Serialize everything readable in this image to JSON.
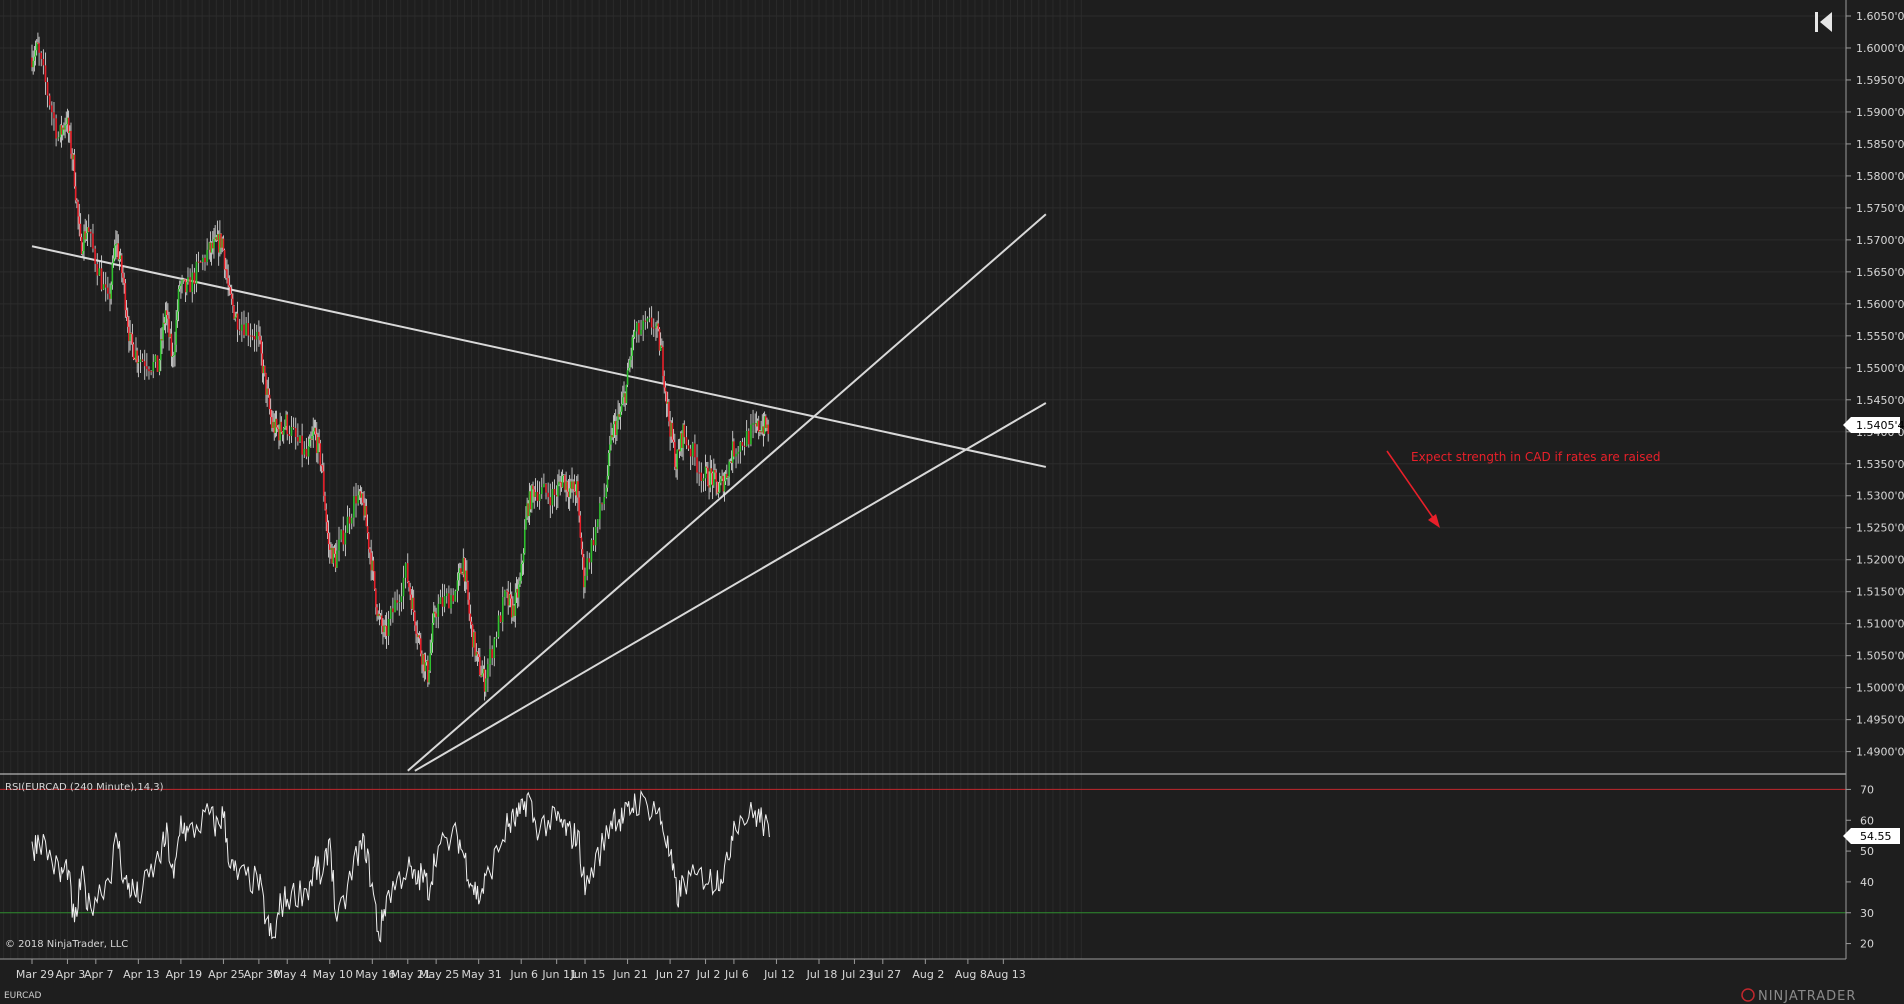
{
  "instrument": "EURCAD",
  "copyright": "© 2018 NinjaTrader, LLC",
  "brand": "NINJATRADER",
  "indicator_label": "RSI(EURCAD (240 Minute),14,3)",
  "price_badge": "1.5405'4",
  "rsi_badge": "54.55",
  "annotation": "Expect strength in CAD if rates are raised",
  "colors": {
    "up": "#2fc12f",
    "down": "#e8202a",
    "line": "#d8d8d8",
    "background": "#1e1e1e",
    "overbought": "#c0272d",
    "oversold": "#2e8b2e",
    "annotation": "#e8202a"
  },
  "chart_data": [
    {
      "type": "candlestick",
      "title": "EURCAD 240 Minute",
      "ylim": [
        1.4865,
        1.6075
      ],
      "y_ticks": [
        1.605,
        1.6,
        1.595,
        1.59,
        1.585,
        1.58,
        1.575,
        1.57,
        1.565,
        1.56,
        1.555,
        1.55,
        1.545,
        1.54,
        1.535,
        1.53,
        1.525,
        1.52,
        1.515,
        1.51,
        1.505,
        1.5,
        1.495,
        1.49
      ],
      "y_tick_labels": [
        "1.6050'0",
        "1.6000'0",
        "1.5950'0",
        "1.5900'0",
        "1.5850'0",
        "1.5800'0",
        "1.5750'0",
        "1.5700'0",
        "1.5650'0",
        "1.5600'0",
        "1.5550'0",
        "1.5500'0",
        "1.5450'0",
        "1.5400'0",
        "1.5350'0",
        "1.5300'0",
        "1.5250'0",
        "1.5200'0",
        "1.5150'0",
        "1.5100'0",
        "1.5050'0",
        "1.5000'0",
        "1.4950'0",
        "1.4900'0"
      ],
      "x_tick_labels": [
        "Mar 29",
        "Apr 3",
        "Apr 7",
        "Apr 13",
        "Apr 19",
        "Apr 25",
        "Apr 30",
        "May 4",
        "May 10",
        "May 16",
        "May 21",
        "May 25",
        "May 31",
        "Jun 6",
        "Jun 11",
        "Jun 15",
        "Jun 21",
        "Jun 27",
        "Jul 2",
        "Jul 6",
        "Jul 12",
        "Jul 18",
        "Jul 23",
        "Jul 27",
        "Aug 2",
        "Aug 8",
        "Aug 13"
      ],
      "anchors": [
        {
          "date": "Mar 29",
          "close": 1.5985
        },
        {
          "date": "Mar 30",
          "close": 1.6
        },
        {
          "date": "Apr 2",
          "close": 1.586
        },
        {
          "date": "Apr 3",
          "close": 1.589
        },
        {
          "date": "Apr 4",
          "close": 1.582
        },
        {
          "date": "Apr 5",
          "close": 1.569
        },
        {
          "date": "Apr 6",
          "close": 1.572
        },
        {
          "date": "Apr 9",
          "close": 1.56
        },
        {
          "date": "Apr 10",
          "close": 1.57
        },
        {
          "date": "Apr 11",
          "close": 1.564
        },
        {
          "date": "Apr 12",
          "close": 1.554
        },
        {
          "date": "Apr 13",
          "close": 1.552
        },
        {
          "date": "Apr 16",
          "close": 1.55
        },
        {
          "date": "Apr 17",
          "close": 1.559
        },
        {
          "date": "Apr 18",
          "close": 1.551
        },
        {
          "date": "Apr 19",
          "close": 1.563
        },
        {
          "date": "Apr 20",
          "close": 1.562
        },
        {
          "date": "Apr 23",
          "close": 1.568
        },
        {
          "date": "Apr 24",
          "close": 1.569
        },
        {
          "date": "Apr 25",
          "close": 1.57
        },
        {
          "date": "Apr 26",
          "close": 1.561
        },
        {
          "date": "Apr 27",
          "close": 1.558
        },
        {
          "date": "Apr 30",
          "close": 1.555
        },
        {
          "date": "May 1",
          "close": 1.548
        },
        {
          "date": "May 2",
          "close": 1.541
        },
        {
          "date": "May 3",
          "close": 1.54
        },
        {
          "date": "May 4",
          "close": 1.5415
        },
        {
          "date": "May 7",
          "close": 1.536
        },
        {
          "date": "May 8",
          "close": 1.54
        },
        {
          "date": "May 9",
          "close": 1.535
        },
        {
          "date": "May 10",
          "close": 1.522
        },
        {
          "date": "May 11",
          "close": 1.52
        },
        {
          "date": "May 14",
          "close": 1.53
        },
        {
          "date": "May 15",
          "close": 1.528
        },
        {
          "date": "May 16",
          "close": 1.52
        },
        {
          "date": "May 17",
          "close": 1.511
        },
        {
          "date": "May 18",
          "close": 1.508
        },
        {
          "date": "May 21",
          "close": 1.518
        },
        {
          "date": "May 22",
          "close": 1.512
        },
        {
          "date": "May 23",
          "close": 1.506
        },
        {
          "date": "May 24",
          "close": 1.502
        },
        {
          "date": "May 25",
          "close": 1.512
        },
        {
          "date": "May 28",
          "close": 1.515
        },
        {
          "date": "May 29",
          "close": 1.52
        },
        {
          "date": "May 30",
          "close": 1.51
        },
        {
          "date": "May 31",
          "close": 1.504
        },
        {
          "date": "Jun 1",
          "close": 1.501
        },
        {
          "date": "Jun 4",
          "close": 1.514
        },
        {
          "date": "Jun 5",
          "close": 1.512
        },
        {
          "date": "Jun 6",
          "close": 1.516
        },
        {
          "date": "Jun 7",
          "close": 1.528
        },
        {
          "date": "Jun 8",
          "close": 1.531
        },
        {
          "date": "Jun 11",
          "close": 1.53
        },
        {
          "date": "Jun 12",
          "close": 1.533
        },
        {
          "date": "Jun 13",
          "close": 1.531
        },
        {
          "date": "Jun 14",
          "close": 1.531
        },
        {
          "date": "Jun 15",
          "close": 1.517
        },
        {
          "date": "Jun 18",
          "close": 1.53
        },
        {
          "date": "Jun 19",
          "close": 1.54
        },
        {
          "date": "Jun 20",
          "close": 1.542
        },
        {
          "date": "Jun 21",
          "close": 1.547
        },
        {
          "date": "Jun 22",
          "close": 1.555
        },
        {
          "date": "Jun 25",
          "close": 1.557
        },
        {
          "date": "Jun 26",
          "close": 1.552
        },
        {
          "date": "Jun 27",
          "close": 1.542
        },
        {
          "date": "Jun 28",
          "close": 1.535
        },
        {
          "date": "Jun 29",
          "close": 1.54
        },
        {
          "date": "Jul 2",
          "close": 1.533
        },
        {
          "date": "Jul 3",
          "close": 1.533
        },
        {
          "date": "Jul 4",
          "close": 1.531
        },
        {
          "date": "Jul 5",
          "close": 1.533
        },
        {
          "date": "Jul 6",
          "close": 1.537
        },
        {
          "date": "Jul 9",
          "close": 1.54
        },
        {
          "date": "Jul 10",
          "close": 1.541
        },
        {
          "date": "Jul 11",
          "close": 1.5405
        }
      ],
      "last_price": 1.54054,
      "trend_lines": [
        {
          "name": "resistance",
          "from": {
            "date": "Mar 29",
            "price": 1.569
          },
          "to": {
            "date": "Aug 19",
            "price": 1.5345
          }
        },
        {
          "name": "rising support",
          "from": {
            "date": "May 21",
            "price": 1.487
          },
          "to": {
            "date": "Aug 19",
            "price": 1.574
          }
        },
        {
          "name": "lower channel",
          "from": {
            "date": "May 22",
            "price": 1.487
          },
          "to": {
            "date": "Aug 19",
            "price": 1.5445
          }
        }
      ]
    },
    {
      "type": "line",
      "title": "RSI(EURCAD (240 Minute),14,3)",
      "ylim": [
        15,
        75
      ],
      "y_ticks": [
        20,
        30,
        40,
        50,
        60,
        70
      ],
      "levels": {
        "overbought": 70,
        "oversold": 30
      },
      "anchors": [
        {
          "date": "Mar 29",
          "value": 50
        },
        {
          "date": "Mar 30",
          "value": 55
        },
        {
          "date": "Apr 2",
          "value": 42
        },
        {
          "date": "Apr 3",
          "value": 45
        },
        {
          "date": "Apr 4",
          "value": 25
        },
        {
          "date": "Apr 5",
          "value": 42
        },
        {
          "date": "Apr 6",
          "value": 32
        },
        {
          "date": "Apr 9",
          "value": 42
        },
        {
          "date": "Apr 10",
          "value": 55
        },
        {
          "date": "Apr 11",
          "value": 40
        },
        {
          "date": "Apr 12",
          "value": 38
        },
        {
          "date": "Apr 13",
          "value": 35
        },
        {
          "date": "Apr 16",
          "value": 48
        },
        {
          "date": "Apr 17",
          "value": 55
        },
        {
          "date": "Apr 18",
          "value": 40
        },
        {
          "date": "Apr 19",
          "value": 60
        },
        {
          "date": "Apr 20",
          "value": 55
        },
        {
          "date": "Apr 23",
          "value": 62
        },
        {
          "date": "Apr 24",
          "value": 58
        },
        {
          "date": "Apr 25",
          "value": 62
        },
        {
          "date": "Apr 26",
          "value": 45
        },
        {
          "date": "Apr 27",
          "value": 42
        },
        {
          "date": "Apr 30",
          "value": 40
        },
        {
          "date": "May 1",
          "value": 28
        },
        {
          "date": "May 2",
          "value": 20
        },
        {
          "date": "May 3",
          "value": 32
        },
        {
          "date": "May 4",
          "value": 35
        },
        {
          "date": "May 7",
          "value": 38
        },
        {
          "date": "May 8",
          "value": 45
        },
        {
          "date": "May 9",
          "value": 40
        },
        {
          "date": "May 10",
          "value": 55
        },
        {
          "date": "May 11",
          "value": 25
        },
        {
          "date": "May 14",
          "value": 50
        },
        {
          "date": "May 15",
          "value": 52
        },
        {
          "date": "May 16",
          "value": 38
        },
        {
          "date": "May 17",
          "value": 22
        },
        {
          "date": "May 18",
          "value": 35
        },
        {
          "date": "May 21",
          "value": 45
        },
        {
          "date": "May 22",
          "value": 40
        },
        {
          "date": "May 23",
          "value": 42
        },
        {
          "date": "May 24",
          "value": 38
        },
        {
          "date": "May 25",
          "value": 50
        },
        {
          "date": "May 28",
          "value": 55
        },
        {
          "date": "May 29",
          "value": 48
        },
        {
          "date": "May 30",
          "value": 40
        },
        {
          "date": "May 31",
          "value": 35
        },
        {
          "date": "Jun 1",
          "value": 40
        },
        {
          "date": "Jun 4",
          "value": 58
        },
        {
          "date": "Jun 5",
          "value": 60
        },
        {
          "date": "Jun 6",
          "value": 62
        },
        {
          "date": "Jun 7",
          "value": 68
        },
        {
          "date": "Jun 8",
          "value": 58
        },
        {
          "date": "Jun 11",
          "value": 60
        },
        {
          "date": "Jun 12",
          "value": 58
        },
        {
          "date": "Jun 13",
          "value": 55
        },
        {
          "date": "Jun 14",
          "value": 55
        },
        {
          "date": "Jun 15",
          "value": 38
        },
        {
          "date": "Jun 18",
          "value": 55
        },
        {
          "date": "Jun 19",
          "value": 62
        },
        {
          "date": "Jun 20",
          "value": 60
        },
        {
          "date": "Jun 21",
          "value": 62
        },
        {
          "date": "Jun 22",
          "value": 66
        },
        {
          "date": "Jun 25",
          "value": 64
        },
        {
          "date": "Jun 26",
          "value": 58
        },
        {
          "date": "Jun 27",
          "value": 48
        },
        {
          "date": "Jun 28",
          "value": 35
        },
        {
          "date": "Jun 29",
          "value": 40
        },
        {
          "date": "Jul 2",
          "value": 42
        },
        {
          "date": "Jul 3",
          "value": 40
        },
        {
          "date": "Jul 4",
          "value": 42
        },
        {
          "date": "Jul 5",
          "value": 45
        },
        {
          "date": "Jul 6",
          "value": 60
        },
        {
          "date": "Jul 9",
          "value": 62
        },
        {
          "date": "Jul 10",
          "value": 60
        },
        {
          "date": "Jul 11",
          "value": 54.55
        }
      ],
      "last_value": 54.55
    }
  ]
}
